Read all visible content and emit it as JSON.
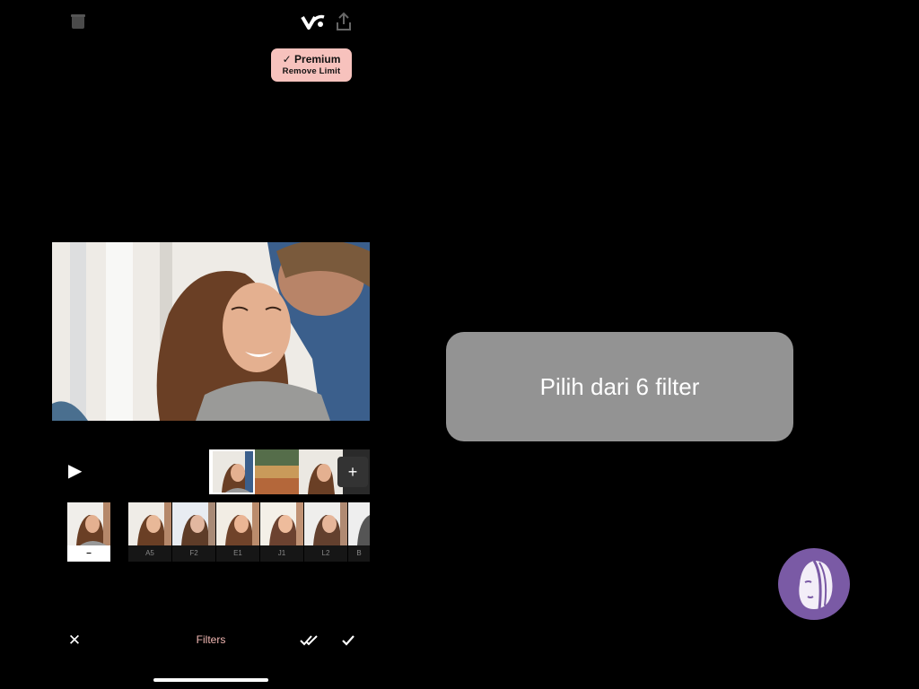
{
  "premium": {
    "line1": "Premium",
    "line2": "Remove Limit"
  },
  "icons": {
    "trash": "trash-icon",
    "logo": "vllo-logo-icon",
    "share": "share-icon",
    "play": "play-icon",
    "add": "add-clip-icon",
    "close": "close-icon",
    "apply_all": "double-check-icon",
    "apply": "check-icon"
  },
  "timeline": {
    "add_label": "+"
  },
  "filters": {
    "none_label": "–",
    "items": [
      "A5",
      "F2",
      "E1",
      "J1",
      "L2",
      "B"
    ]
  },
  "bottom_bar": {
    "title": "Filters"
  },
  "caption": {
    "text": "Pilih dari 6 filter"
  },
  "colors": {
    "premium_bg": "#f7c2bd",
    "accent": "#f2b8b3",
    "caption_bg": "#939393",
    "badge_bg": "#7a5aa5"
  }
}
